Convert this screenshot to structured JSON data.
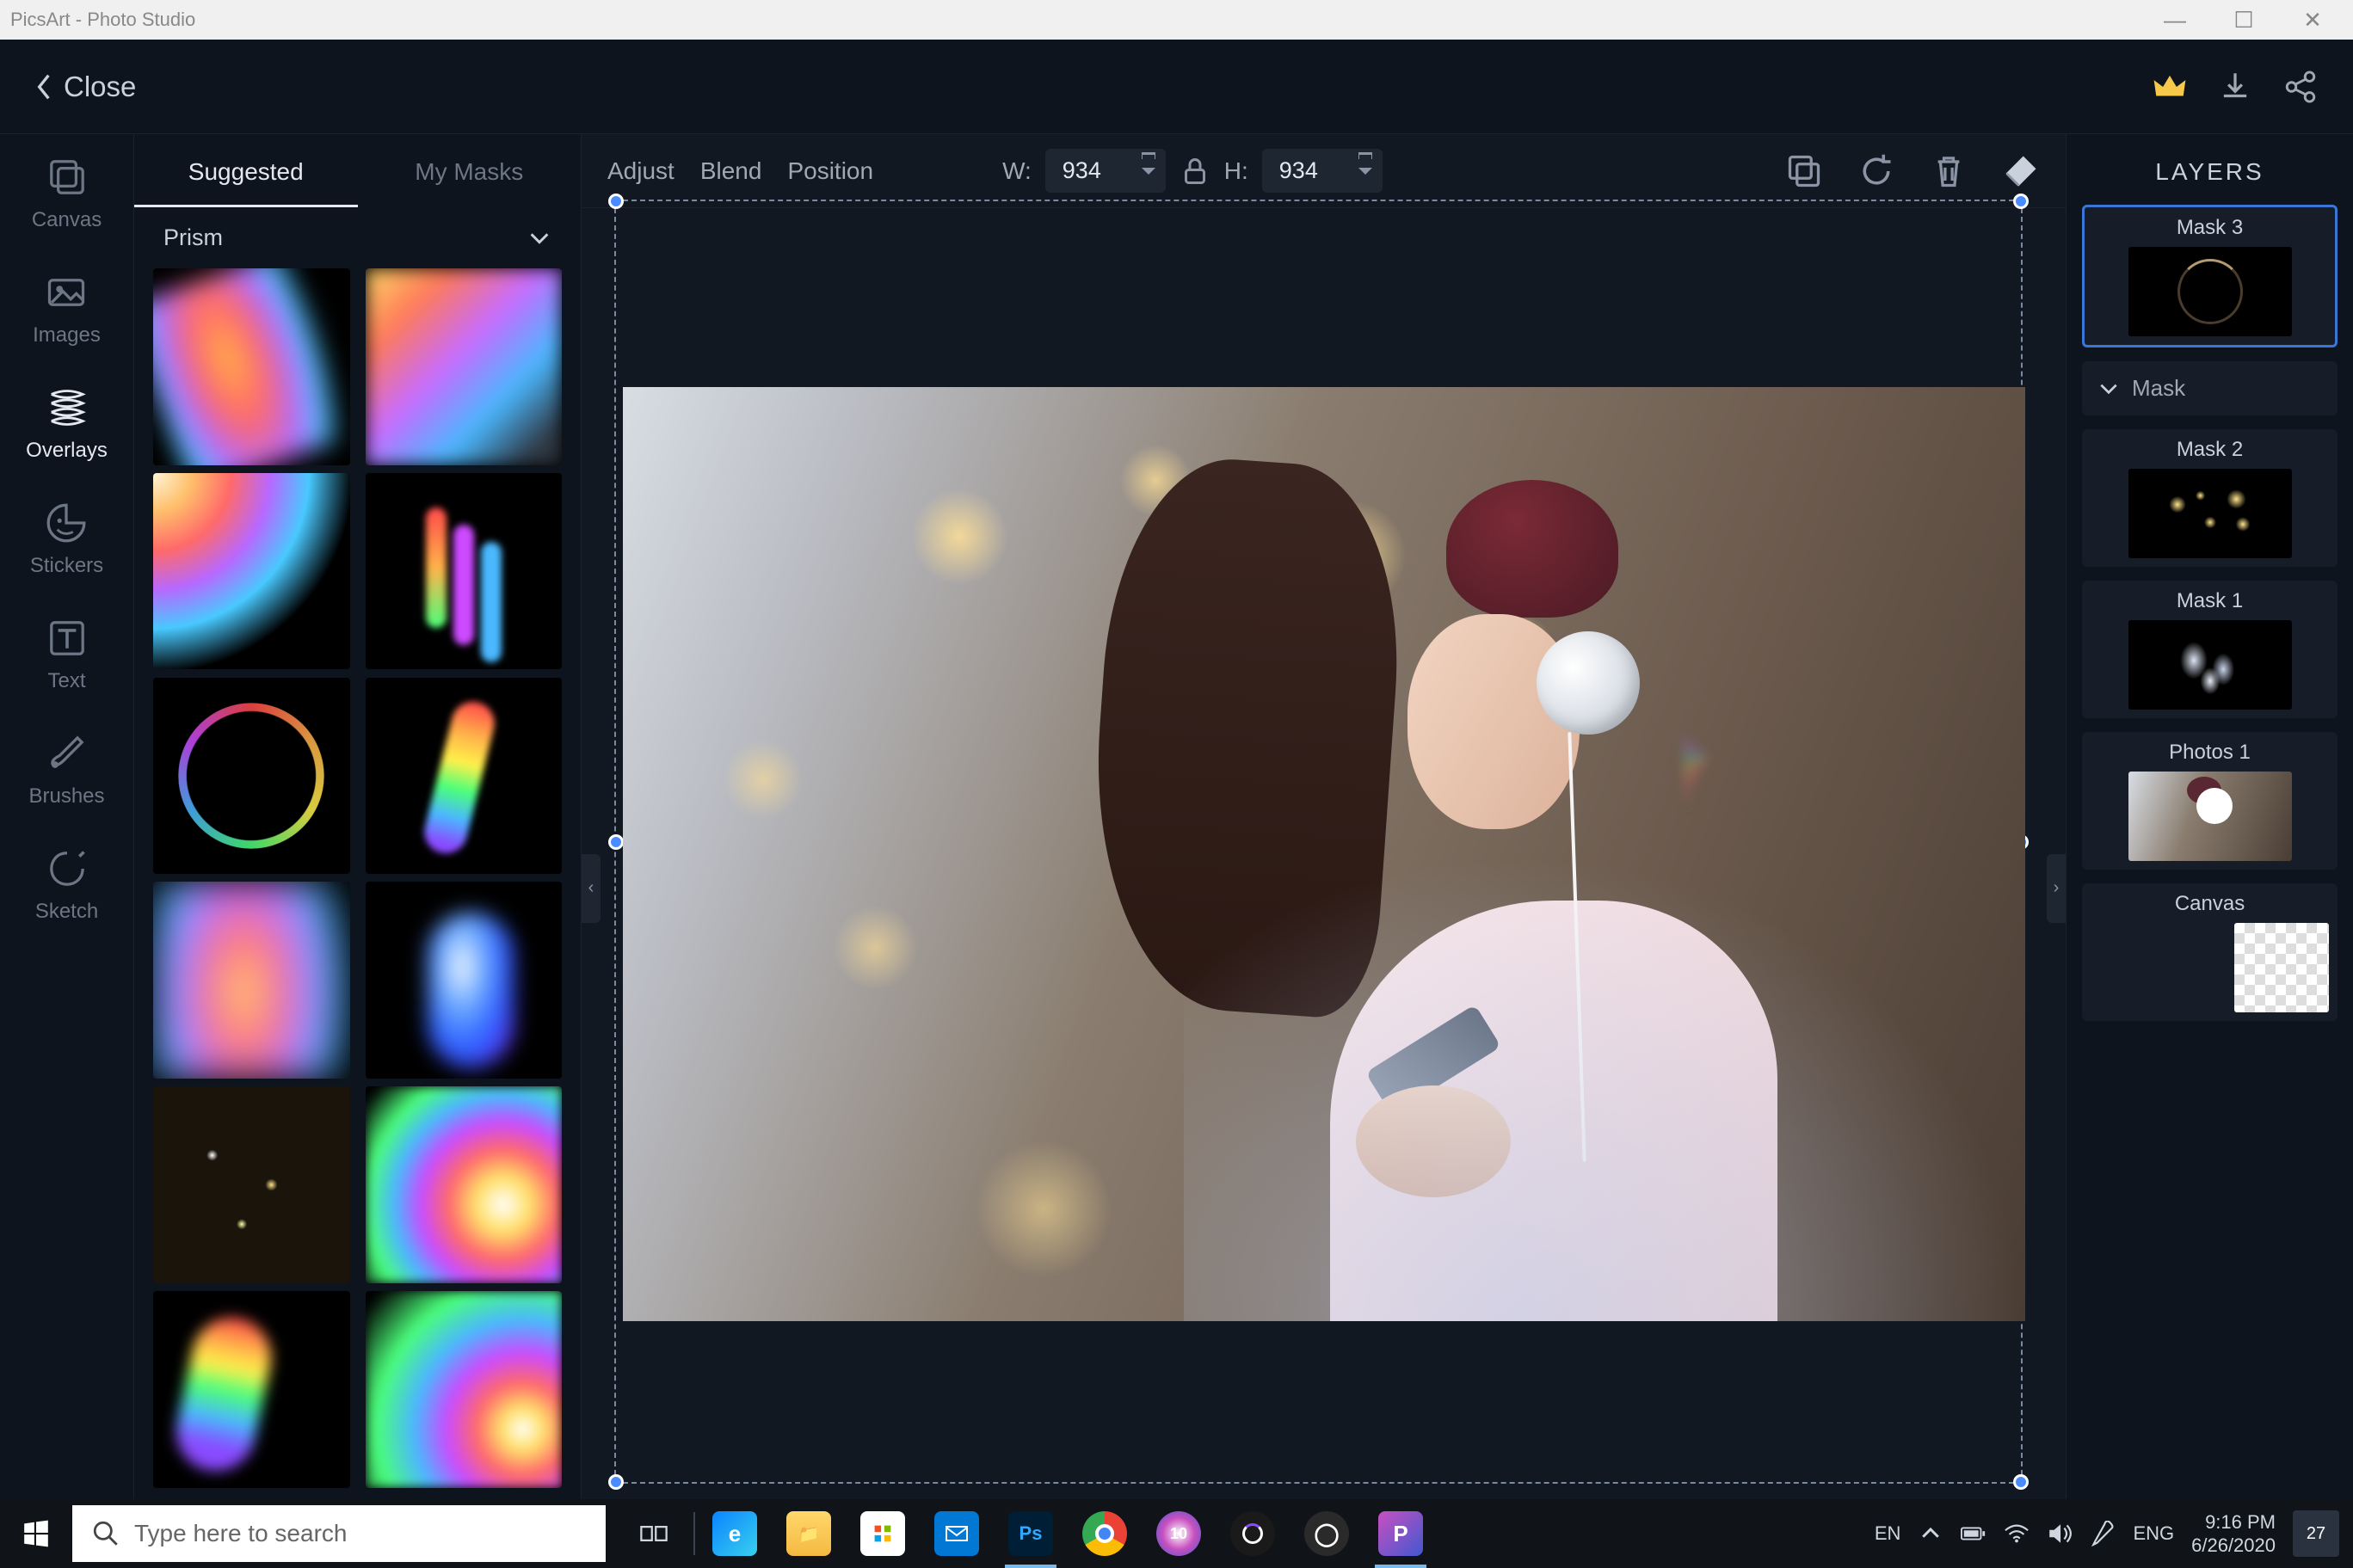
{
  "window": {
    "title": "PicsArt - Photo Studio"
  },
  "topbar": {
    "close": "Close"
  },
  "tools": {
    "canvas": "Canvas",
    "images": "Images",
    "overlays": "Overlays",
    "stickers": "Stickers",
    "text": "Text",
    "brushes": "Brushes",
    "sketch": "Sketch"
  },
  "overlay_panel": {
    "tabs": {
      "suggested": "Suggested",
      "my_masks": "My Masks"
    },
    "category": "Prism"
  },
  "canvas_toolbar": {
    "adjust": "Adjust",
    "blend": "Blend",
    "position": "Position",
    "w_label": "W:",
    "h_label": "H:",
    "width": "934",
    "height": "934"
  },
  "layers": {
    "title": "LAYERS",
    "items": [
      "Mask 3",
      "Mask 2",
      "Mask 1",
      "Photos 1",
      "Canvas"
    ],
    "mask_group": "Mask"
  },
  "taskbar": {
    "search_placeholder": "Type here to search",
    "lang1": "EN",
    "lang2": "ENG",
    "time": "9:16 PM",
    "date": "6/26/2020",
    "notif_count": "27"
  }
}
